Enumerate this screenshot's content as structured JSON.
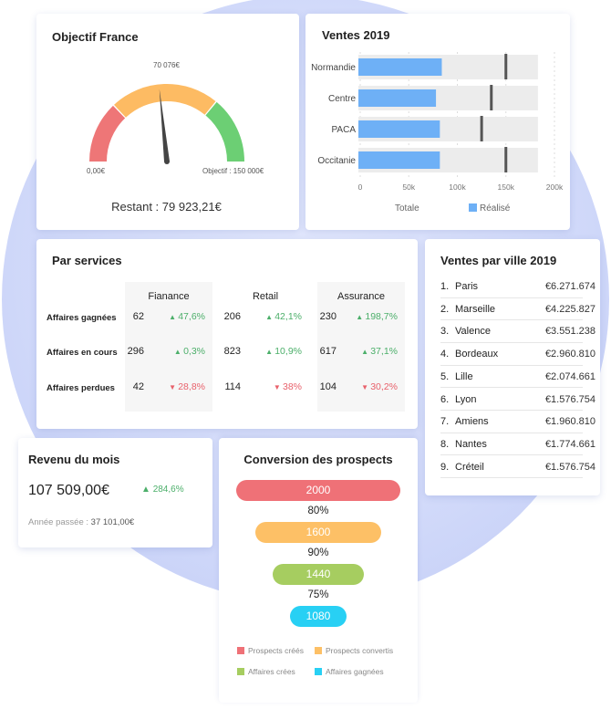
{
  "objectif": {
    "title": "Objectif France",
    "value_label": "70 076€",
    "min_label": "0,00€",
    "max_label": "Objectif : 150 000€",
    "remaining": "Restant : 79 923,21€",
    "value": 70076,
    "max": 150000,
    "colors": [
      "#ee7677",
      "#fdbb63",
      "#6ccf74"
    ]
  },
  "ventes": {
    "title": "Ventes 2019",
    "categories": [
      "Normandie",
      "Centre",
      "PACA",
      "Occitanie"
    ],
    "realise": [
      84000,
      78000,
      82000,
      82000
    ],
    "totale": [
      183000,
      183000,
      183000,
      183000
    ],
    "cible": [
      150000,
      135000,
      125000,
      150000
    ],
    "ticks": [
      "0",
      "50k",
      "100k",
      "150k",
      "200k"
    ],
    "xlim": [
      0,
      200000
    ],
    "legend_totale": "Totale",
    "legend_realise": "Réalisé",
    "bar_color": "#6eb0f6"
  },
  "services": {
    "title": "Par services",
    "columns": [
      "Fianance",
      "Retail",
      "Assurance"
    ],
    "rows": [
      "Affaires gagnées",
      "Affaires en cours",
      "Affaires perdues"
    ],
    "values": [
      [
        [
          "62",
          "47,6%",
          "up"
        ],
        [
          "206",
          "42,1%",
          "up"
        ],
        [
          "230",
          "198,7%",
          "up"
        ]
      ],
      [
        [
          "296",
          "0,3%",
          "up"
        ],
        [
          "823",
          "10,9%",
          "up"
        ],
        [
          "617",
          "37,1%",
          "up"
        ]
      ],
      [
        [
          "42",
          "28,8%",
          "down"
        ],
        [
          "114",
          "38%",
          "down"
        ],
        [
          "104",
          "30,2%",
          "down"
        ]
      ]
    ]
  },
  "villes": {
    "title": "Ventes par ville 2019",
    "items": [
      [
        "1.",
        "Paris",
        "€6.271.674"
      ],
      [
        "2.",
        "Marseille",
        "€4.225.827"
      ],
      [
        "3.",
        "Valence",
        "€3.551.238"
      ],
      [
        "4.",
        "Bordeaux",
        "€2.960.810"
      ],
      [
        "5.",
        "Lille",
        "€2.074.661"
      ],
      [
        "6.",
        "Lyon",
        "€1.576.754"
      ],
      [
        "7.",
        "Amiens",
        "€1.960.810"
      ],
      [
        "8.",
        "Nantes",
        "€1.774.661"
      ],
      [
        "9.",
        "Créteil",
        "€1.576.754"
      ]
    ]
  },
  "revenu": {
    "title": "Revenu du mois",
    "value": "107 509,00€",
    "change": "284,6%",
    "previous_label": "Année passée : ",
    "previous_value": "37 101,00€"
  },
  "conversion": {
    "title": "Conversion des prospects",
    "stages": [
      {
        "value": "2000",
        "color": "#ef7177",
        "legend": "Prospects créés"
      },
      {
        "value": "1600",
        "color": "#fdc066",
        "legend": "Prospects convertis"
      },
      {
        "value": "1440",
        "color": "#a6cd60",
        "legend": "Affaires crées"
      },
      {
        "value": "1080",
        "color": "#28d0f4",
        "legend": "Affaires gagnées"
      }
    ],
    "rates": [
      "80%",
      "90%",
      "75%"
    ]
  }
}
